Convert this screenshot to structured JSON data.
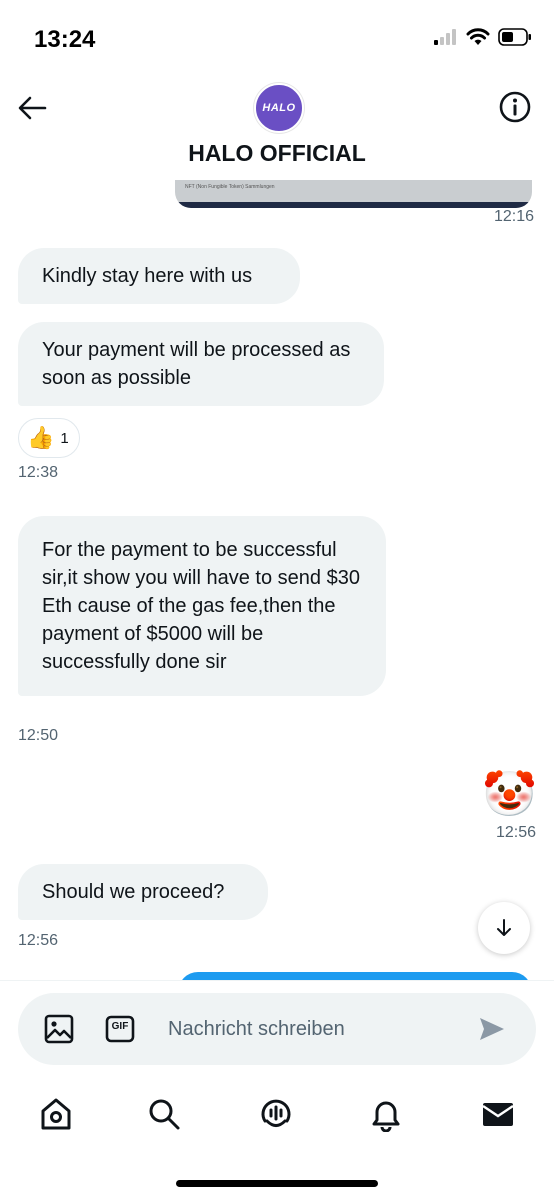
{
  "status_bar": {
    "time": "13:24"
  },
  "header": {
    "avatar_text": "HALO",
    "name": "HALO OFFICIAL"
  },
  "messages": {
    "media_caption": "NFT (Non Fungible Token) Sammlungen",
    "media_time": "12:16",
    "m1": "Kindly stay here with us",
    "m2": "Your payment will be processed as soon as possible",
    "reaction_emoji": "👍",
    "reaction_count": "1",
    "t2": "12:38",
    "m3": "For the payment to be successful sir,it show you will have to send $30 Eth cause of the gas fee,then the payment of $5000 will be successfully done sir",
    "t3": "12:50",
    "clown_emoji": "🤡",
    "t4": "12:56",
    "m5": "Should we proceed?",
    "t5": "12:56"
  },
  "composer": {
    "placeholder": "Nachricht schreiben",
    "gif_label": "GIF"
  },
  "colors": {
    "accent": "#1d9bf0",
    "avatar": "#6a4fc4",
    "bubble": "#eff3f4",
    "muted": "#536471"
  },
  "icons": {
    "back": "arrow-left-icon",
    "info": "info-icon",
    "image": "image-icon",
    "gif": "gif-icon",
    "send": "send-icon",
    "scroll": "arrow-down-icon",
    "nav": [
      "home-icon",
      "search-icon",
      "spaces-icon",
      "bell-icon",
      "mail-icon"
    ]
  }
}
